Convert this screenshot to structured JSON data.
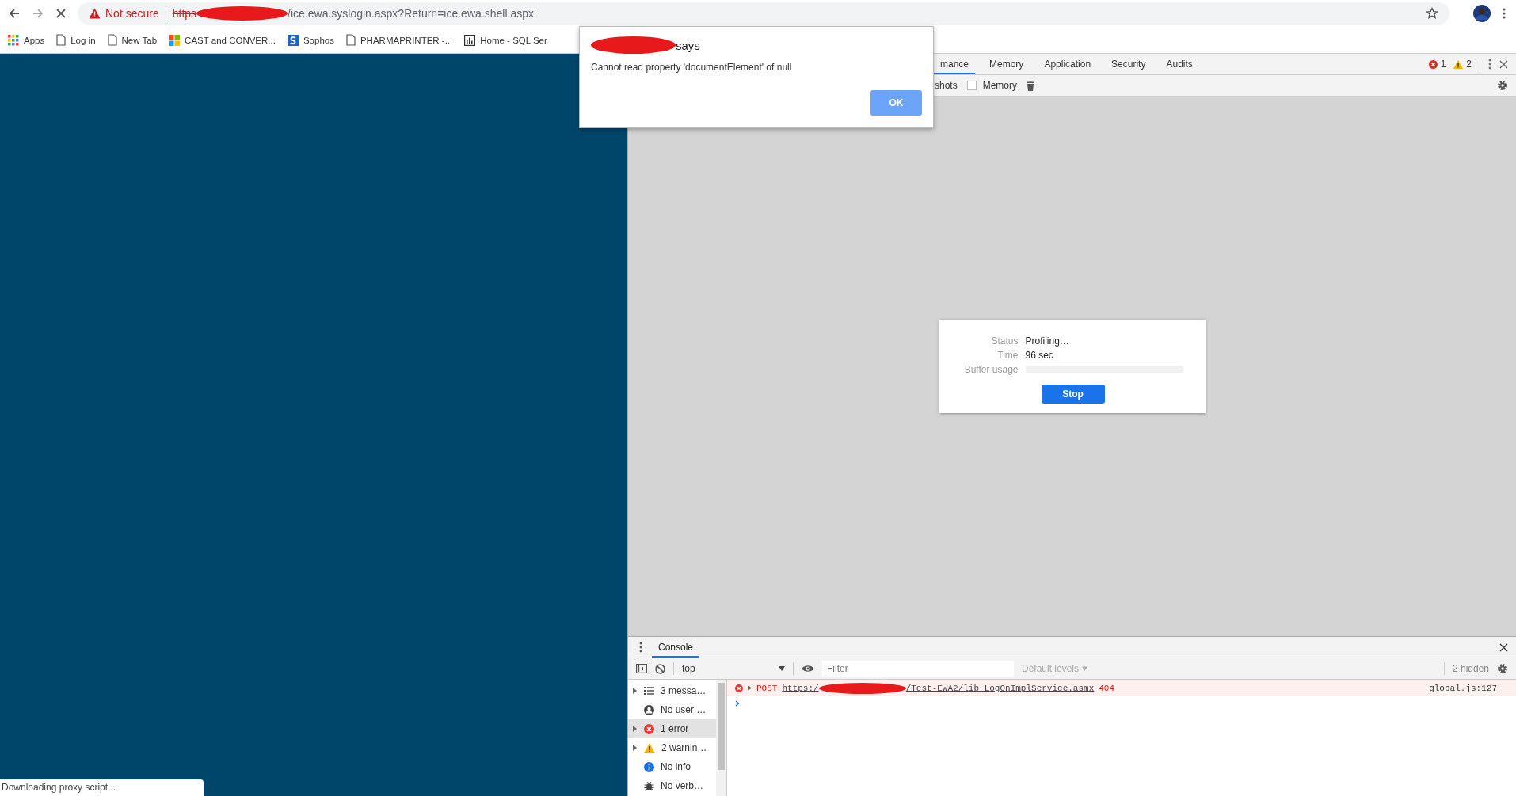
{
  "address_bar": {
    "security_label": "Not secure",
    "url_scheme": "https",
    "url_path": "/ice.ewa.syslogin.aspx?Return=ice.ewa.shell.aspx"
  },
  "bookmarks": [
    {
      "label": "Apps",
      "kind": "apps"
    },
    {
      "label": "Log in",
      "kind": "page"
    },
    {
      "label": "New Tab",
      "kind": "page"
    },
    {
      "label": "CAST and CONVER...",
      "kind": "tiles"
    },
    {
      "label": "Sophos",
      "kind": "shield"
    },
    {
      "label": "PHARMAPRINTER -...",
      "kind": "page"
    },
    {
      "label": "Home - SQL Ser",
      "kind": "chart"
    }
  ],
  "alert_dialog": {
    "title": "says",
    "message": "Cannot read property 'documentElement' of null",
    "button": "OK"
  },
  "devtools": {
    "tabs": [
      {
        "label": "mance",
        "selected": true
      },
      {
        "label": "Memory",
        "selected": false
      },
      {
        "label": "Application",
        "selected": false
      },
      {
        "label": "Security",
        "selected": false
      },
      {
        "label": "Audits",
        "selected": false
      }
    ],
    "error_count": "1",
    "warning_count": "2",
    "toolbar": {
      "label": "shots",
      "memory_checkbox": {
        "label": "Memory",
        "checked": false
      }
    },
    "profiling": {
      "rows": [
        {
          "label": "Status",
          "value": "Profiling…"
        },
        {
          "label": "Time",
          "value": "96 sec"
        },
        {
          "label": "Buffer usage",
          "level": 0
        }
      ],
      "button": "Stop"
    }
  },
  "console": {
    "tab": "Console",
    "context": "top",
    "filter_placeholder": "Filter",
    "levels": "Default levels",
    "hidden_count": "2 hidden",
    "sidebar": [
      {
        "label": "3 messa…",
        "kind": "messages",
        "expandable": true,
        "selected": false
      },
      {
        "label": "No user …",
        "kind": "user",
        "expandable": false,
        "selected": false
      },
      {
        "label": "1 error",
        "kind": "error",
        "expandable": true,
        "selected": true
      },
      {
        "label": "2 warnin…",
        "kind": "warning",
        "expandable": true,
        "selected": false
      },
      {
        "label": "No info",
        "kind": "info",
        "expandable": false,
        "selected": false
      },
      {
        "label": "No verb…",
        "kind": "verbose",
        "expandable": false,
        "selected": false
      }
    ],
    "messages": [
      {
        "kind": "error",
        "method": "POST",
        "url_scheme": "https:/",
        "url_path": "/Test-EWA2/lib_LogOnImplService.asmx",
        "status": "404",
        "source": "global.js:127"
      }
    ]
  },
  "status_bubble": "Downloading proxy script..."
}
